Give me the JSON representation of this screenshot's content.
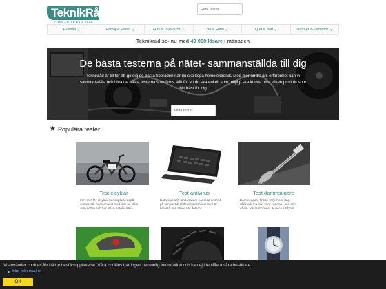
{
  "brand": {
    "name": "TeknikRåd",
    "subtitle": "KÖPRÅD SEDAN 2006"
  },
  "header": {
    "search_placeholder": "Hitta tester"
  },
  "nav": {
    "items": [
      {
        "label": "Hushåll"
      },
      {
        "label": "Familj & Hälsa"
      },
      {
        "label": "Hus & Villavaror"
      },
      {
        "label": "Bil & Fritid"
      },
      {
        "label": "Ljud & Bild"
      },
      {
        "label": "Datorer & Tillbehör"
      }
    ]
  },
  "tagline": {
    "prefix": "Teknikråd.se- nu med ",
    "highlight": "40 000 läsare",
    "suffix": " i månaden"
  },
  "hero": {
    "title": "De bästa testerna på nätet- sammanställda till dig",
    "text": "Teknikråd är till för att ge dig de bästa köpråden när du ska köpa hemelektronik. Med mer än 10 års erfarenhet kan vi sammanställa och hitta de bästa testerna som finns. Allt för att du ska enkelt som möjligt ska kunna hitta vilken produkt som blir bäst för dig",
    "search_placeholder": "Hitta tester"
  },
  "popular": {
    "title": "Populära tester",
    "cards": [
      {
        "title": "Test elcyklar",
        "desc": "Intresset för elcyklar har exploderat på senare tid. Även antalet modeller se olika som är bra och hur stilen betalar 25%."
      },
      {
        "title": "Test antivirus",
        "desc": "Datavirus och ransomware har ökat enormt på senare tid. Hitta vilka antivirus som är bra och inte säkar när datorn."
      },
      {
        "title": "Test dammsugare",
        "desc": "Dammsugare finns i varje hem idag. Skillnaderna kan vara enorma i pris och effekt. Vår testvinnare är även ett fynd."
      },
      {
        "title": "",
        "desc": ""
      },
      {
        "title": "",
        "desc": ""
      },
      {
        "title": "",
        "desc": ""
      }
    ]
  },
  "cookie": {
    "text": "Vi använder cookies för bättre besöksupplevelse. Våra cookies har ingen personlig information och kan ej identifiera våra besökare.",
    "link": "Mer information",
    "ok": "OK"
  },
  "colors": {
    "accent": "#3c8b84",
    "cookie_bg": "#1d1d1d",
    "ok_button": "#f3d81e"
  }
}
